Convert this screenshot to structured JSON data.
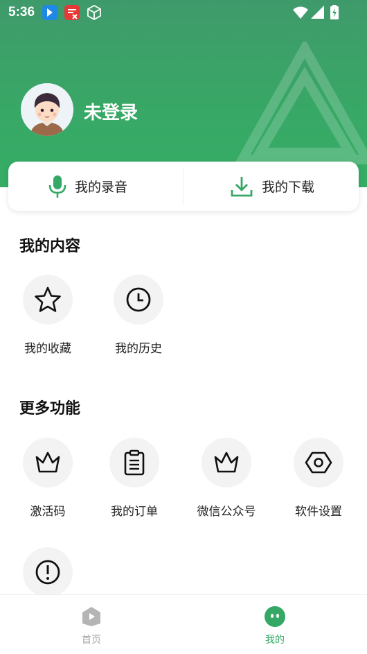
{
  "status_bar": {
    "time": "5:36"
  },
  "profile": {
    "username": "未登录"
  },
  "quick_actions": [
    {
      "label": "我的录音",
      "icon": "microphone-icon"
    },
    {
      "label": "我的下载",
      "icon": "download-icon"
    }
  ],
  "my_content": {
    "title": "我的内容",
    "items": [
      {
        "label": "我的收藏",
        "icon": "star-icon"
      },
      {
        "label": "我的历史",
        "icon": "clock-icon"
      }
    ]
  },
  "more_features": {
    "title": "更多功能",
    "items": [
      {
        "label": "激活码",
        "icon": "crown-icon"
      },
      {
        "label": "我的订单",
        "icon": "clipboard-icon"
      },
      {
        "label": "微信公众号",
        "icon": "crown-icon"
      },
      {
        "label": "软件设置",
        "icon": "hexagon-settings-icon"
      },
      {
        "label": "",
        "icon": "info-circle-icon"
      }
    ]
  },
  "tab_bar": {
    "tabs": [
      {
        "label": "首页",
        "icon": "home-play-icon",
        "active": false
      },
      {
        "label": "我的",
        "icon": "mine-face-icon",
        "active": true
      }
    ]
  },
  "colors": {
    "accent": "#35a865",
    "inactive": "#a6a6a6",
    "tile_bg": "#f3f3f3"
  }
}
